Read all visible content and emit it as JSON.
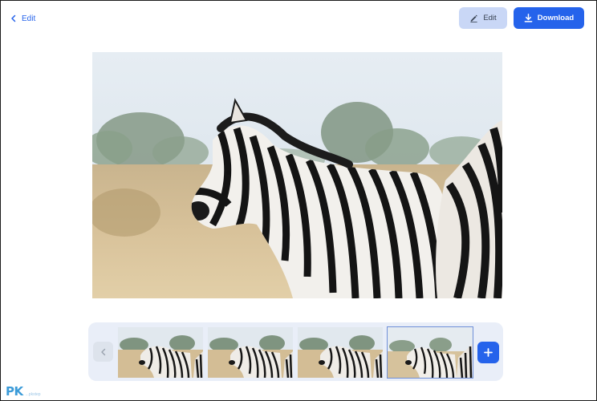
{
  "header": {
    "back_label": "Edit",
    "edit_label": "Edit",
    "download_label": "Download"
  },
  "thumbnails": {
    "count": 4,
    "selected_index": 3
  },
  "colors": {
    "accent": "#2563eb",
    "edit_button_bg": "#c9d7f6",
    "thumbbar_bg": "#e9eef8"
  },
  "watermark": {
    "logo_text": "PK",
    "logo_sub": "...pkstep"
  }
}
